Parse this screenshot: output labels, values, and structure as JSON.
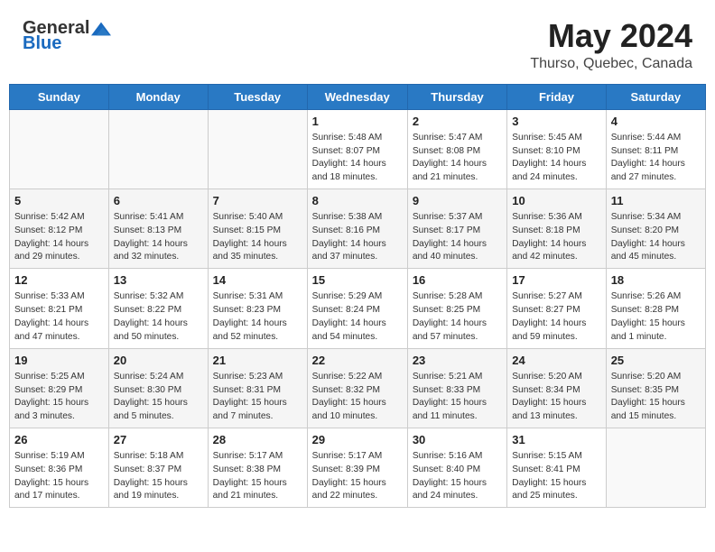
{
  "header": {
    "logo_general": "General",
    "logo_blue": "Blue",
    "month_year": "May 2024",
    "location": "Thurso, Quebec, Canada"
  },
  "days_of_week": [
    "Sunday",
    "Monday",
    "Tuesday",
    "Wednesday",
    "Thursday",
    "Friday",
    "Saturday"
  ],
  "weeks": [
    [
      {
        "day": "",
        "info": ""
      },
      {
        "day": "",
        "info": ""
      },
      {
        "day": "",
        "info": ""
      },
      {
        "day": "1",
        "info": "Sunrise: 5:48 AM\nSunset: 8:07 PM\nDaylight: 14 hours\nand 18 minutes."
      },
      {
        "day": "2",
        "info": "Sunrise: 5:47 AM\nSunset: 8:08 PM\nDaylight: 14 hours\nand 21 minutes."
      },
      {
        "day": "3",
        "info": "Sunrise: 5:45 AM\nSunset: 8:10 PM\nDaylight: 14 hours\nand 24 minutes."
      },
      {
        "day": "4",
        "info": "Sunrise: 5:44 AM\nSunset: 8:11 PM\nDaylight: 14 hours\nand 27 minutes."
      }
    ],
    [
      {
        "day": "5",
        "info": "Sunrise: 5:42 AM\nSunset: 8:12 PM\nDaylight: 14 hours\nand 29 minutes."
      },
      {
        "day": "6",
        "info": "Sunrise: 5:41 AM\nSunset: 8:13 PM\nDaylight: 14 hours\nand 32 minutes."
      },
      {
        "day": "7",
        "info": "Sunrise: 5:40 AM\nSunset: 8:15 PM\nDaylight: 14 hours\nand 35 minutes."
      },
      {
        "day": "8",
        "info": "Sunrise: 5:38 AM\nSunset: 8:16 PM\nDaylight: 14 hours\nand 37 minutes."
      },
      {
        "day": "9",
        "info": "Sunrise: 5:37 AM\nSunset: 8:17 PM\nDaylight: 14 hours\nand 40 minutes."
      },
      {
        "day": "10",
        "info": "Sunrise: 5:36 AM\nSunset: 8:18 PM\nDaylight: 14 hours\nand 42 minutes."
      },
      {
        "day": "11",
        "info": "Sunrise: 5:34 AM\nSunset: 8:20 PM\nDaylight: 14 hours\nand 45 minutes."
      }
    ],
    [
      {
        "day": "12",
        "info": "Sunrise: 5:33 AM\nSunset: 8:21 PM\nDaylight: 14 hours\nand 47 minutes."
      },
      {
        "day": "13",
        "info": "Sunrise: 5:32 AM\nSunset: 8:22 PM\nDaylight: 14 hours\nand 50 minutes."
      },
      {
        "day": "14",
        "info": "Sunrise: 5:31 AM\nSunset: 8:23 PM\nDaylight: 14 hours\nand 52 minutes."
      },
      {
        "day": "15",
        "info": "Sunrise: 5:29 AM\nSunset: 8:24 PM\nDaylight: 14 hours\nand 54 minutes."
      },
      {
        "day": "16",
        "info": "Sunrise: 5:28 AM\nSunset: 8:25 PM\nDaylight: 14 hours\nand 57 minutes."
      },
      {
        "day": "17",
        "info": "Sunrise: 5:27 AM\nSunset: 8:27 PM\nDaylight: 14 hours\nand 59 minutes."
      },
      {
        "day": "18",
        "info": "Sunrise: 5:26 AM\nSunset: 8:28 PM\nDaylight: 15 hours\nand 1 minute."
      }
    ],
    [
      {
        "day": "19",
        "info": "Sunrise: 5:25 AM\nSunset: 8:29 PM\nDaylight: 15 hours\nand 3 minutes."
      },
      {
        "day": "20",
        "info": "Sunrise: 5:24 AM\nSunset: 8:30 PM\nDaylight: 15 hours\nand 5 minutes."
      },
      {
        "day": "21",
        "info": "Sunrise: 5:23 AM\nSunset: 8:31 PM\nDaylight: 15 hours\nand 7 minutes."
      },
      {
        "day": "22",
        "info": "Sunrise: 5:22 AM\nSunset: 8:32 PM\nDaylight: 15 hours\nand 10 minutes."
      },
      {
        "day": "23",
        "info": "Sunrise: 5:21 AM\nSunset: 8:33 PM\nDaylight: 15 hours\nand 11 minutes."
      },
      {
        "day": "24",
        "info": "Sunrise: 5:20 AM\nSunset: 8:34 PM\nDaylight: 15 hours\nand 13 minutes."
      },
      {
        "day": "25",
        "info": "Sunrise: 5:20 AM\nSunset: 8:35 PM\nDaylight: 15 hours\nand 15 minutes."
      }
    ],
    [
      {
        "day": "26",
        "info": "Sunrise: 5:19 AM\nSunset: 8:36 PM\nDaylight: 15 hours\nand 17 minutes."
      },
      {
        "day": "27",
        "info": "Sunrise: 5:18 AM\nSunset: 8:37 PM\nDaylight: 15 hours\nand 19 minutes."
      },
      {
        "day": "28",
        "info": "Sunrise: 5:17 AM\nSunset: 8:38 PM\nDaylight: 15 hours\nand 21 minutes."
      },
      {
        "day": "29",
        "info": "Sunrise: 5:17 AM\nSunset: 8:39 PM\nDaylight: 15 hours\nand 22 minutes."
      },
      {
        "day": "30",
        "info": "Sunrise: 5:16 AM\nSunset: 8:40 PM\nDaylight: 15 hours\nand 24 minutes."
      },
      {
        "day": "31",
        "info": "Sunrise: 5:15 AM\nSunset: 8:41 PM\nDaylight: 15 hours\nand 25 minutes."
      },
      {
        "day": "",
        "info": ""
      }
    ]
  ]
}
